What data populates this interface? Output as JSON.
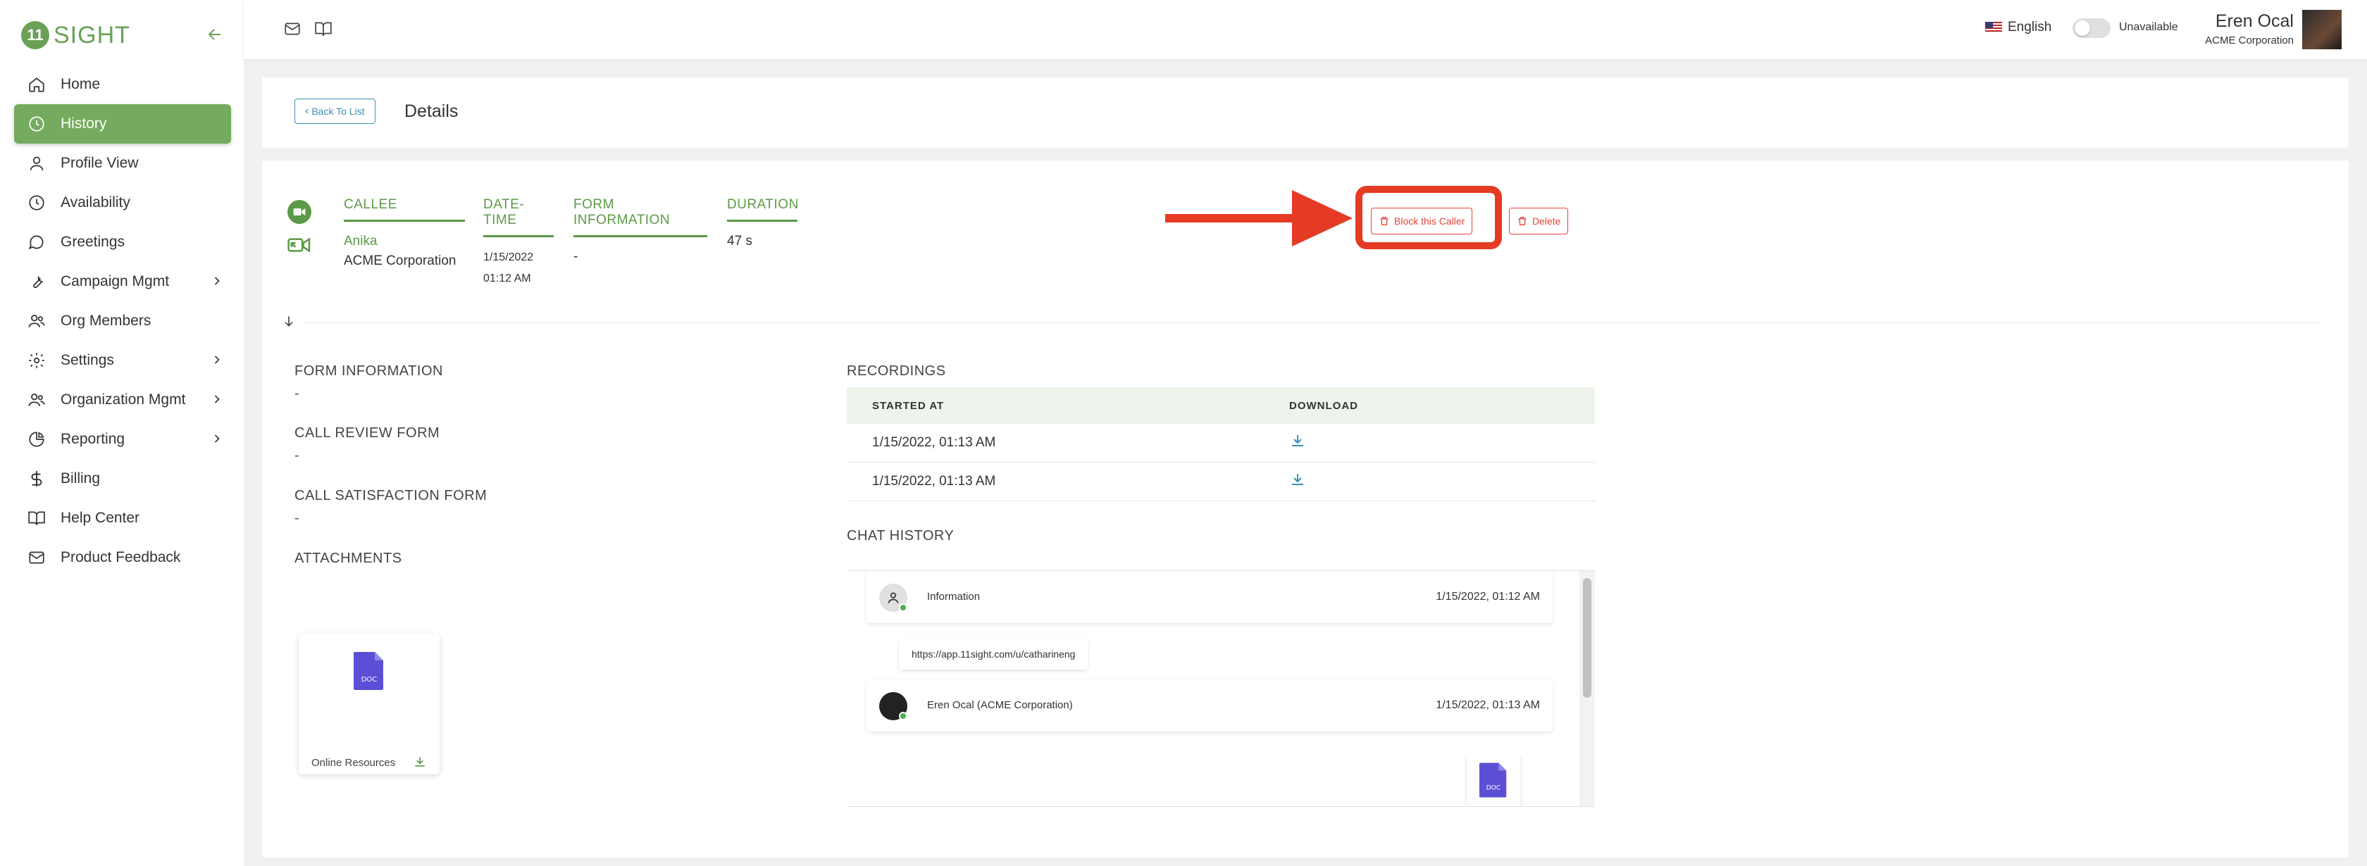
{
  "sidebar": {
    "logo_mark": "11",
    "logo_text": "SIGHT",
    "items": [
      {
        "label": "Home",
        "icon": "home-icon",
        "active": false,
        "has_chevron": false
      },
      {
        "label": "History",
        "icon": "clock-icon",
        "active": true,
        "has_chevron": false
      },
      {
        "label": "Profile View",
        "icon": "user-icon",
        "active": false,
        "has_chevron": false
      },
      {
        "label": "Availability",
        "icon": "clock-icon",
        "active": false,
        "has_chevron": false
      },
      {
        "label": "Greetings",
        "icon": "chat-bubble-icon",
        "active": false,
        "has_chevron": false
      },
      {
        "label": "Campaign Mgmt",
        "icon": "wrench-icon",
        "active": false,
        "has_chevron": true
      },
      {
        "label": "Org Members",
        "icon": "users-icon",
        "active": false,
        "has_chevron": false
      },
      {
        "label": "Settings",
        "icon": "gear-icon",
        "active": false,
        "has_chevron": true
      },
      {
        "label": "Organization Mgmt",
        "icon": "users-icon",
        "active": false,
        "has_chevron": true
      },
      {
        "label": "Reporting",
        "icon": "pie-chart-icon",
        "active": false,
        "has_chevron": true
      },
      {
        "label": "Billing",
        "icon": "dollar-icon",
        "active": false,
        "has_chevron": false
      },
      {
        "label": "Help Center",
        "icon": "book-icon",
        "active": false,
        "has_chevron": false
      },
      {
        "label": "Product Feedback",
        "icon": "mail-icon",
        "active": false,
        "has_chevron": false
      }
    ]
  },
  "topbar": {
    "language": "English",
    "availability_label": "Unavailable",
    "user_name": "Eren Ocal",
    "user_org": "ACME Corporation"
  },
  "header": {
    "back_label": "Back To List",
    "back_chevron": "‹",
    "title": "Details"
  },
  "call": {
    "columns": [
      "CALLEE",
      "DATE-TIME",
      "FORM INFORMATION",
      "DURATION"
    ],
    "callee_name": "Anika",
    "callee_org": "ACME Corporation",
    "date": "1/15/2022",
    "time": "01:12 AM",
    "form_info": "-",
    "duration": "47 s"
  },
  "actions": {
    "block_label": "Block this Caller",
    "delete_label": "Delete"
  },
  "sections": {
    "form_information": {
      "label": "FORM INFORMATION",
      "value": "-"
    },
    "call_review_form": {
      "label": "CALL REVIEW FORM",
      "value": "-"
    },
    "call_satisfaction_form": {
      "label": "CALL SATISFACTION FORM",
      "value": "-"
    },
    "attachments": {
      "label": "ATTACHMENTS",
      "file_name": "Online Resources",
      "file_type": "DOC"
    }
  },
  "recordings": {
    "label": "RECORDINGS",
    "headers": [
      "STARTED AT",
      "DOWNLOAD"
    ],
    "rows": [
      {
        "started_at": "1/15/2022, 01:13 AM"
      },
      {
        "started_at": "1/15/2022, 01:13 AM"
      }
    ]
  },
  "chat": {
    "label": "CHAT HISTORY",
    "messages": [
      {
        "name": "Information",
        "time": "1/15/2022, 01:12 AM"
      },
      {
        "name": "Eren Ocal (ACME Corporation)",
        "time": "1/15/2022, 01:13 AM"
      }
    ],
    "link": "https://app.11sight.com/u/catharineng",
    "doc_type": "DOC"
  },
  "colors": {
    "brand_green": "#74ab5e",
    "accent_blue": "#3c8fb5",
    "danger_red": "#e0453a",
    "annotation_red": "#e53b24",
    "doc_purple": "#5b4fd6"
  }
}
